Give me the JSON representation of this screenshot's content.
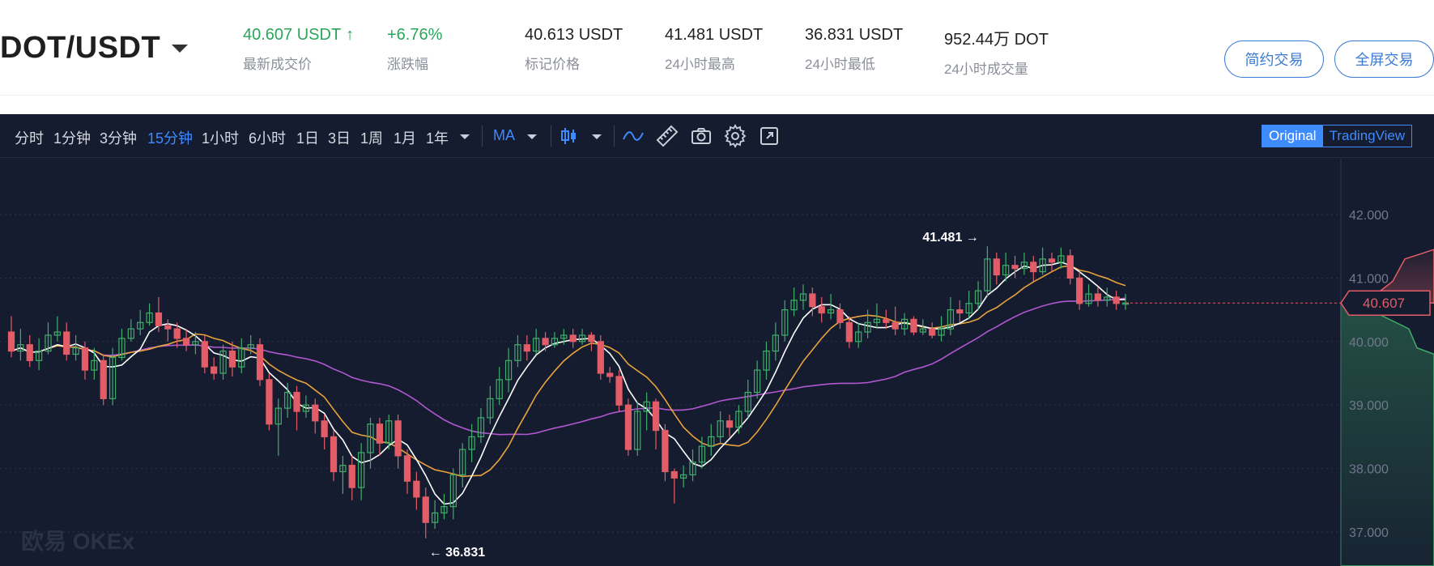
{
  "header": {
    "pair": "DOT/USDT",
    "stats": [
      {
        "value": "40.607 USDT",
        "label": "最新成交价",
        "up": true
      },
      {
        "value": "+6.76%",
        "label": "涨跌幅",
        "up": true
      },
      {
        "value": "40.613 USDT",
        "label": "标记价格",
        "up": false
      },
      {
        "value": "41.481 USDT",
        "label": "24小时最高",
        "up": false
      },
      {
        "value": "36.831 USDT",
        "label": "24小时最低",
        "up": false
      },
      {
        "value": "952.44万 DOT",
        "label": "24小时成交量",
        "up": false
      }
    ],
    "buttons": {
      "simple": "简约交易",
      "fullscreen": "全屏交易"
    }
  },
  "toolbar": {
    "timeframes": [
      "分时",
      "1分钟",
      "3分钟",
      "15分钟",
      "1小时",
      "6小时",
      "1日",
      "3日",
      "1周",
      "1月",
      "1年"
    ],
    "active_timeframe": "15分钟",
    "indicator": "MA",
    "view_original": "Original",
    "view_tradingview": "TradingView",
    "icons": [
      "candlestick-icon",
      "line-style-icon",
      "ruler-icon",
      "camera-icon",
      "gear-icon",
      "expand-icon"
    ]
  },
  "chart_data": {
    "type": "candlestick",
    "y_ticks": [
      "42.000",
      "41.000",
      "40.000",
      "39.000",
      "38.000",
      "37.000"
    ],
    "ylim": [
      36.7,
      42.2
    ],
    "current_price": "40.607",
    "high_label": "41.481",
    "low_label": "36.831",
    "watermark": "欧易 OKEx",
    "colors": {
      "up": "#3fae6a",
      "down": "#e25d67",
      "ma5": "#ffffff",
      "ma10": "#e8a33d",
      "ma30": "#b157d1",
      "grid": "#2b3448"
    },
    "candles": [
      [
        40.15,
        39.85,
        40.4,
        39.75
      ],
      [
        39.85,
        39.95,
        40.2,
        39.7
      ],
      [
        39.95,
        39.7,
        40.1,
        39.6
      ],
      [
        39.7,
        39.85,
        40.05,
        39.55
      ],
      [
        39.85,
        40.1,
        40.3,
        39.8
      ],
      [
        40.1,
        40.15,
        40.4,
        40.0
      ],
      [
        40.15,
        39.8,
        40.3,
        39.7
      ],
      [
        39.8,
        39.9,
        40.1,
        39.7
      ],
      [
        39.9,
        39.55,
        40.0,
        39.4
      ],
      [
        39.55,
        39.7,
        39.9,
        39.4
      ],
      [
        39.7,
        39.1,
        39.8,
        39.0
      ],
      [
        39.1,
        39.75,
        39.9,
        39.0
      ],
      [
        39.75,
        40.05,
        40.2,
        39.7
      ],
      [
        40.05,
        40.2,
        40.35,
        40.0
      ],
      [
        40.2,
        40.3,
        40.5,
        40.1
      ],
      [
        40.3,
        40.45,
        40.6,
        40.25
      ],
      [
        40.45,
        40.25,
        40.7,
        40.15
      ],
      [
        40.25,
        40.2,
        40.35,
        40.0
      ],
      [
        40.2,
        40.05,
        40.3,
        39.9
      ],
      [
        40.05,
        39.95,
        40.2,
        39.85
      ],
      [
        39.95,
        40.0,
        40.15,
        39.8
      ],
      [
        40.0,
        39.6,
        40.1,
        39.5
      ],
      [
        39.6,
        39.5,
        39.75,
        39.4
      ],
      [
        39.5,
        39.85,
        39.95,
        39.4
      ],
      [
        39.85,
        39.6,
        40.0,
        39.45
      ],
      [
        39.6,
        39.9,
        40.05,
        39.5
      ],
      [
        39.9,
        39.95,
        40.1,
        39.8
      ],
      [
        39.95,
        39.4,
        40.05,
        39.3
      ],
      [
        39.4,
        38.7,
        39.5,
        38.6
      ],
      [
        38.7,
        38.95,
        39.1,
        38.2
      ],
      [
        38.95,
        39.2,
        39.35,
        38.8
      ],
      [
        39.2,
        38.9,
        39.3,
        38.6
      ],
      [
        38.9,
        39.0,
        39.15,
        38.8
      ],
      [
        39.0,
        38.75,
        39.1,
        38.55
      ],
      [
        38.75,
        38.5,
        38.85,
        38.3
      ],
      [
        38.5,
        37.95,
        38.6,
        37.8
      ],
      [
        37.95,
        38.05,
        38.2,
        37.6
      ],
      [
        38.05,
        37.7,
        38.2,
        37.5
      ],
      [
        37.7,
        38.25,
        38.4,
        37.5
      ],
      [
        38.25,
        38.7,
        38.8,
        38.0
      ],
      [
        38.7,
        38.4,
        38.8,
        38.2
      ],
      [
        38.4,
        38.75,
        38.85,
        38.3
      ],
      [
        38.75,
        38.2,
        38.85,
        38.0
      ],
      [
        38.2,
        37.8,
        38.3,
        37.6
      ],
      [
        37.8,
        37.55,
        37.95,
        37.35
      ],
      [
        37.55,
        37.15,
        37.7,
        36.9
      ],
      [
        37.15,
        37.3,
        37.5,
        37.05
      ],
      [
        37.3,
        37.4,
        37.6,
        37.2
      ],
      [
        37.4,
        37.9,
        38.0,
        37.2
      ],
      [
        37.9,
        38.3,
        38.4,
        37.7
      ],
      [
        38.3,
        38.5,
        38.7,
        38.1
      ],
      [
        38.5,
        38.8,
        38.95,
        38.4
      ],
      [
        38.8,
        39.1,
        39.3,
        38.7
      ],
      [
        39.1,
        39.4,
        39.6,
        39.0
      ],
      [
        39.4,
        39.7,
        39.9,
        39.2
      ],
      [
        39.7,
        39.95,
        40.1,
        39.6
      ],
      [
        39.95,
        39.85,
        40.1,
        39.7
      ],
      [
        39.85,
        40.05,
        40.2,
        39.8
      ],
      [
        40.05,
        39.95,
        40.15,
        39.85
      ],
      [
        39.95,
        40.05,
        40.15,
        39.9
      ],
      [
        40.05,
        40.1,
        40.2,
        39.95
      ],
      [
        40.1,
        40.0,
        40.2,
        39.9
      ],
      [
        40.0,
        40.1,
        40.2,
        39.95
      ],
      [
        40.1,
        40.0,
        40.15,
        39.85
      ],
      [
        40.0,
        39.5,
        40.1,
        39.4
      ],
      [
        39.5,
        39.45,
        39.6,
        39.35
      ],
      [
        39.45,
        39.0,
        39.55,
        38.9
      ],
      [
        39.0,
        38.3,
        39.1,
        38.2
      ],
      [
        38.3,
        38.9,
        39.05,
        38.2
      ],
      [
        38.9,
        39.05,
        39.2,
        38.6
      ],
      [
        39.05,
        38.6,
        39.1,
        38.3
      ],
      [
        38.6,
        37.95,
        38.7,
        37.8
      ],
      [
        37.95,
        37.85,
        38.0,
        37.45
      ],
      [
        37.85,
        37.9,
        38.05,
        37.7
      ],
      [
        37.9,
        38.1,
        38.3,
        37.8
      ],
      [
        38.1,
        38.35,
        38.5,
        38.0
      ],
      [
        38.35,
        38.5,
        38.7,
        38.2
      ],
      [
        38.5,
        38.75,
        38.9,
        38.4
      ],
      [
        38.75,
        38.65,
        38.85,
        38.5
      ],
      [
        38.65,
        38.9,
        39.0,
        38.55
      ],
      [
        38.9,
        39.2,
        39.4,
        38.8
      ],
      [
        39.2,
        39.55,
        39.7,
        39.1
      ],
      [
        39.55,
        39.85,
        40.0,
        39.4
      ],
      [
        39.85,
        40.1,
        40.3,
        39.7
      ],
      [
        40.1,
        40.5,
        40.65,
        40.0
      ],
      [
        40.5,
        40.65,
        40.85,
        40.4
      ],
      [
        40.65,
        40.75,
        40.9,
        40.5
      ],
      [
        40.75,
        40.55,
        40.85,
        40.4
      ],
      [
        40.55,
        40.45,
        40.7,
        40.3
      ],
      [
        40.45,
        40.5,
        40.75,
        40.35
      ],
      [
        40.5,
        40.3,
        40.6,
        40.2
      ],
      [
        40.3,
        40.0,
        40.4,
        39.9
      ],
      [
        40.0,
        40.15,
        40.3,
        39.9
      ],
      [
        40.15,
        40.3,
        40.5,
        40.05
      ],
      [
        40.3,
        40.35,
        40.6,
        40.2
      ],
      [
        40.35,
        40.3,
        40.5,
        40.2
      ],
      [
        40.3,
        40.2,
        40.55,
        40.1
      ],
      [
        40.2,
        40.35,
        40.45,
        40.1
      ],
      [
        40.35,
        40.15,
        40.4,
        40.1
      ],
      [
        40.15,
        40.2,
        40.35,
        40.1
      ],
      [
        40.2,
        40.1,
        40.3,
        40.05
      ],
      [
        40.1,
        40.2,
        40.4,
        40.0
      ],
      [
        40.2,
        40.5,
        40.7,
        40.1
      ],
      [
        40.5,
        40.45,
        40.65,
        40.3
      ],
      [
        40.45,
        40.6,
        40.8,
        40.35
      ],
      [
        40.6,
        40.8,
        40.95,
        40.5
      ],
      [
        40.8,
        41.3,
        41.5,
        40.7
      ],
      [
        41.3,
        41.05,
        41.4,
        40.9
      ],
      [
        41.05,
        41.2,
        41.4,
        40.95
      ],
      [
        41.2,
        41.15,
        41.35,
        41.0
      ],
      [
        41.15,
        41.25,
        41.4,
        41.05
      ],
      [
        41.25,
        41.1,
        41.35,
        40.95
      ],
      [
        41.1,
        41.3,
        41.48,
        41.05
      ],
      [
        41.3,
        41.25,
        41.4,
        41.1
      ],
      [
        41.25,
        41.35,
        41.48,
        41.15
      ],
      [
        41.35,
        41.0,
        41.45,
        40.9
      ],
      [
        41.0,
        40.6,
        41.1,
        40.5
      ],
      [
        40.6,
        40.75,
        40.9,
        40.55
      ],
      [
        40.75,
        40.65,
        40.85,
        40.55
      ],
      [
        40.65,
        40.7,
        40.85,
        40.55
      ],
      [
        40.7,
        40.6,
        40.8,
        40.5
      ],
      [
        40.6,
        40.607,
        40.75,
        40.5
      ]
    ]
  }
}
